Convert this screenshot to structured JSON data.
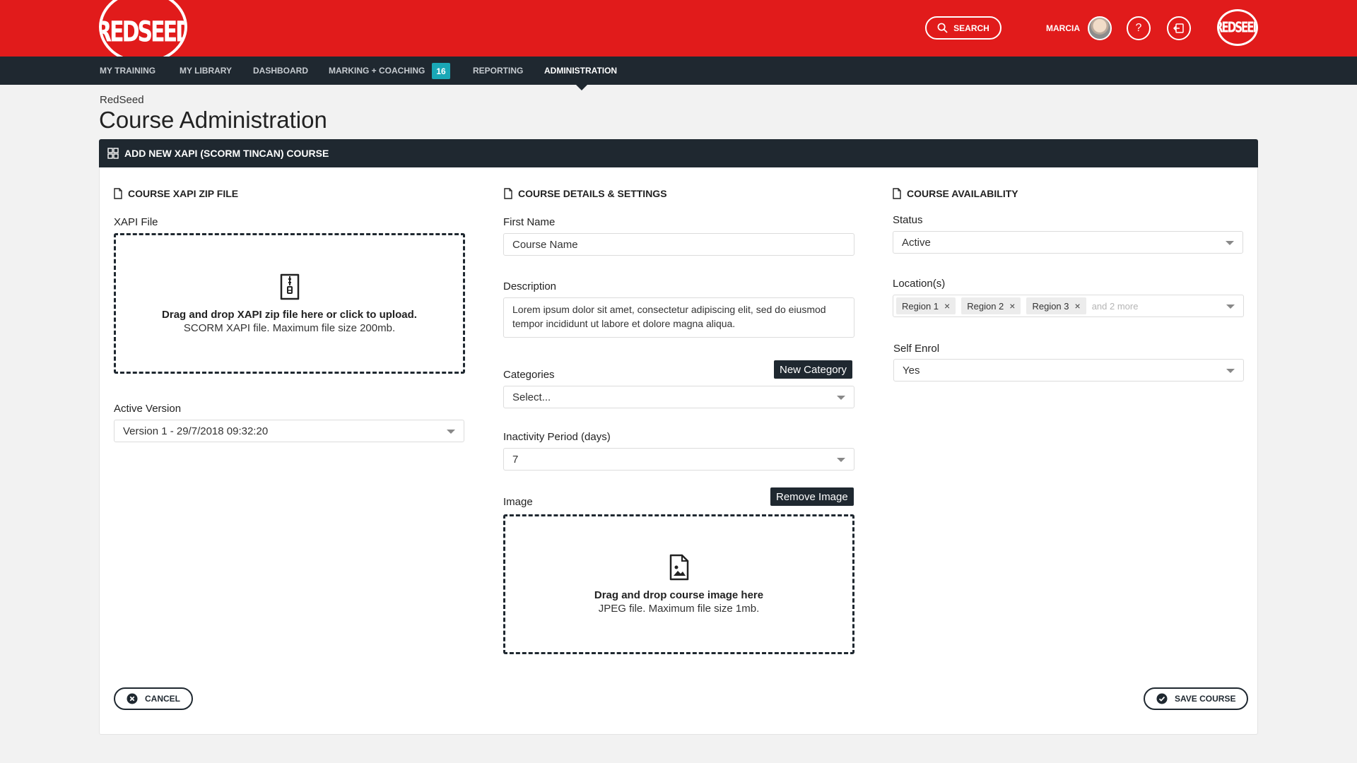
{
  "header": {
    "logo_text": "REDSEED",
    "search_label": "SEARCH",
    "user_name": "MARCIA",
    "help_glyph": "?",
    "brand_color": "#e11b1b"
  },
  "nav": {
    "items": [
      {
        "label": "MY TRAINING"
      },
      {
        "label": "MY LIBRARY"
      },
      {
        "label": "DASHBOARD"
      },
      {
        "label": "MARKING + COACHING",
        "badge": "16"
      },
      {
        "label": "REPORTING"
      },
      {
        "label": "ADMINISTRATION",
        "active": true
      }
    ]
  },
  "page": {
    "breadcrumb": "RedSeed",
    "title": "Course Administration"
  },
  "card": {
    "title": "ADD NEW XAPI (SCORM TINCAN) COURSE"
  },
  "zip_section": {
    "title": "COURSE XAPI ZIP FILE",
    "file_label": "XAPI File",
    "dropzone_main": "Drag and drop XAPI zip file here or click to upload.",
    "dropzone_sub": "SCORM XAPI file. Maximum file size 200mb.",
    "version_label": "Active Version",
    "version_value": "Version 1 - 29/7/2018 09:32:20"
  },
  "details_section": {
    "title": "COURSE DETAILS & SETTINGS",
    "name_label": "First Name",
    "name_value": "Course Name",
    "description_label": "Description",
    "description_value": "Lorem ipsum dolor sit amet, consectetur adipiscing elit, sed do eiusmod tempor incididunt ut labore et dolore magna aliqua.",
    "categories_label": "Categories",
    "new_category_button": "New Category",
    "categories_placeholder": "Select...",
    "inactivity_label": "Inactivity Period (days)",
    "inactivity_value": "7",
    "image_label": "Image",
    "remove_image_button": "Remove Image",
    "image_dropzone_main": "Drag and drop course image here",
    "image_dropzone_sub": "JPEG file. Maximum file size 1mb."
  },
  "availability_section": {
    "title": "COURSE AVAILABILITY",
    "status_label": "Status",
    "status_value": "Active",
    "locations_label": "Location(s)",
    "locations": [
      "Region 1",
      "Region 2",
      "Region 3"
    ],
    "locations_more": "and 2 more",
    "self_enrol_label": "Self Enrol",
    "self_enrol_value": "Yes"
  },
  "footer": {
    "cancel_label": "CANCEL",
    "save_label": "SAVE COURSE"
  },
  "icons": {
    "search": "search-icon",
    "help": "help-icon",
    "logout": "logout-icon",
    "grid": "grid-icon",
    "document": "document-icon",
    "zip_file": "zip-file-icon",
    "image_file": "image-file-icon",
    "cancel": "cancel-circle-icon",
    "check": "check-circle-icon"
  }
}
